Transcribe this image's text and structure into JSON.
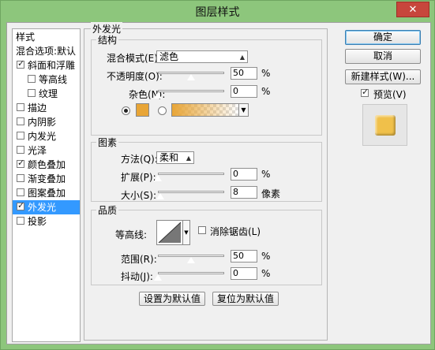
{
  "window": {
    "title": "图层样式",
    "close_glyph": "✕"
  },
  "sidebar": {
    "header": "样式",
    "blend_options": "混合选项:默认",
    "items": [
      {
        "label": "斜面和浮雕",
        "checked": true
      },
      {
        "label": "等高线",
        "checked": false
      },
      {
        "label": "纹理",
        "checked": false
      },
      {
        "label": "描边",
        "checked": false
      },
      {
        "label": "内阴影",
        "checked": false
      },
      {
        "label": "内发光",
        "checked": false
      },
      {
        "label": "光泽",
        "checked": false
      },
      {
        "label": "颜色叠加",
        "checked": true
      },
      {
        "label": "渐变叠加",
        "checked": false
      },
      {
        "label": "图案叠加",
        "checked": false
      },
      {
        "label": "外发光",
        "checked": true,
        "selected": true
      },
      {
        "label": "投影",
        "checked": false
      }
    ],
    "check_glyph": "✓"
  },
  "panel": {
    "title": "外发光",
    "structure": {
      "title": "结构",
      "blend_mode_label": "混合模式(E):",
      "blend_mode_value": "滤色",
      "opacity_label": "不透明度(O):",
      "opacity_value": "50",
      "opacity_fraction": 0.5,
      "noise_label": "杂色(N):",
      "noise_value": "0",
      "noise_fraction": 0,
      "unit": "%",
      "glow_color": "#e8a536"
    },
    "elements": {
      "title": "图素",
      "technique_label": "方法(Q):",
      "technique_value": "柔和",
      "spread_label": "扩展(P):",
      "spread_value": "0",
      "spread_fraction": 0,
      "size_label": "大小(S):",
      "size_value": "8",
      "size_fraction": 0.03,
      "percent_unit": "%",
      "px_unit": "像素"
    },
    "quality": {
      "title": "品质",
      "contour_label": "等高线:",
      "antialias_label": "消除锯齿(L)",
      "antialias_checked": false,
      "range_label": "范围(R):",
      "range_value": "50",
      "range_fraction": 0.5,
      "jitter_label": "抖动(J):",
      "jitter_value": "0",
      "jitter_fraction": 0,
      "unit": "%"
    },
    "make_default": "设置为默认值",
    "reset_default": "复位为默认值"
  },
  "actions": {
    "ok": "确定",
    "cancel": "取消",
    "new_style": "新建样式(W)...",
    "preview_label": "预览(V)",
    "preview_checked": true,
    "preview_swatch_color": "#f0c04a"
  }
}
